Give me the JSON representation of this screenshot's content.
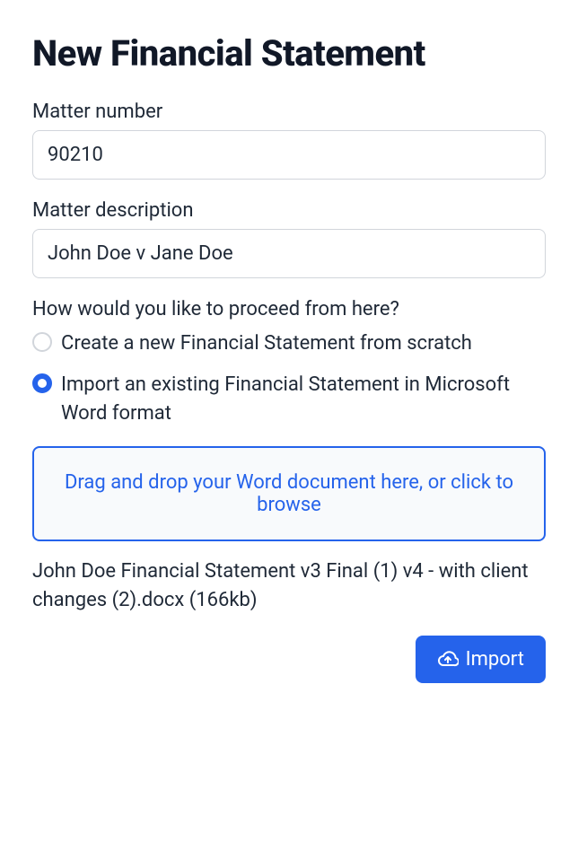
{
  "title": "New Financial Statement",
  "fields": {
    "matter_number": {
      "label": "Matter number",
      "value": "90210"
    },
    "matter_description": {
      "label": "Matter description",
      "value": "John Doe v Jane Doe"
    }
  },
  "proceed": {
    "question": "How would you like to proceed from here?",
    "options": [
      {
        "label": "Create a new Financial Statement from scratch",
        "selected": false
      },
      {
        "label": "Import an existing Financial Statement in Microsoft Word format",
        "selected": true
      }
    ]
  },
  "dropzone": {
    "text": "Drag and drop your Word document here, or click to browse"
  },
  "file": {
    "display": "John Doe Financial Statement v3 Final (1) v4 - with client changes (2).docx (166kb)"
  },
  "import_button": {
    "label": "Import"
  }
}
